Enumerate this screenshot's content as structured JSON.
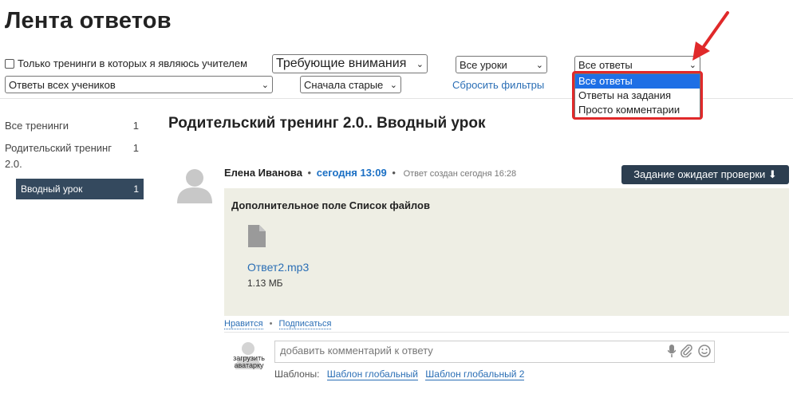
{
  "page": {
    "title": "Лента ответов"
  },
  "filters": {
    "teacher_only_label": "Только тренинги в которых я являюсь учителем",
    "status_select": "Требующие внимания",
    "lessons_select": "Все уроки",
    "answer_type_select": "Все ответы",
    "students_select": "Ответы всех учеников",
    "sort_select": "Сначала старые",
    "reset_link": "Сбросить фильтры"
  },
  "dropdown": {
    "options": [
      "Все ответы",
      "Ответы на задания",
      "Просто комментарии"
    ],
    "selected_index": 0
  },
  "sidebar": {
    "items": [
      {
        "label": "Все тренинги",
        "count": "1"
      },
      {
        "label": "Родительский тренинг 2.0.",
        "count": "1"
      },
      {
        "label": "Вводный урок",
        "count": "1"
      }
    ]
  },
  "lesson": {
    "title": "Родительский тренинг 2.0.. Вводный урок"
  },
  "answer": {
    "author": "Елена Иванова",
    "separator": "•",
    "time": "сегодня 13:09",
    "created": "Ответ создан сегодня 16:28",
    "status_button": "Задание ожидает проверки ⬇",
    "field_title": "Дополнительное поле Список файлов",
    "file_name": "Ответ2.mp3",
    "file_size": "1.13 МБ",
    "like_link": "Нравится",
    "subscribe_link": "Подписаться"
  },
  "comment": {
    "placeholder": "добавить комментарий к ответу",
    "upload_avatar": "загрузить аватарку",
    "templates_label": "Шаблоны:",
    "templates": [
      "Шаблон глобальный",
      "Шаблон глобальный 2"
    ]
  },
  "icons": {
    "microphone": "microphone-icon",
    "paperclip": "paperclip-icon",
    "smiley": "smiley-icon",
    "file": "file-icon",
    "avatar": "avatar-placeholder-icon"
  },
  "colors": {
    "accent_link": "#2a6eb5",
    "sidebar_active": "#34495e",
    "status_button": "#2c3e50",
    "highlight": "#e0292a",
    "selected_option": "#1e6fe5"
  }
}
